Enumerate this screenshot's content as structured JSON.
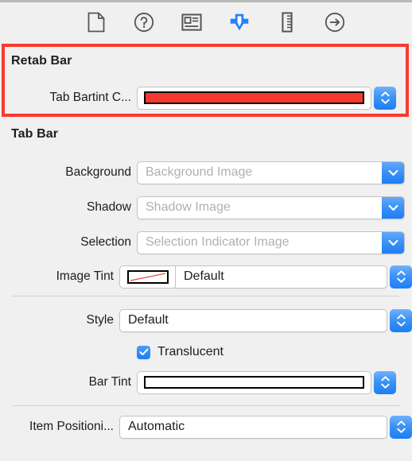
{
  "toolbar": {
    "items": [
      {
        "name": "file-inspector-icon",
        "title": "File inspector"
      },
      {
        "name": "quick-help-inspector-icon",
        "title": "Quick Help inspector"
      },
      {
        "name": "identity-inspector-icon",
        "title": "Identity inspector"
      },
      {
        "name": "attributes-inspector-icon",
        "title": "Attributes inspector",
        "selected": true
      },
      {
        "name": "size-inspector-icon",
        "title": "Size inspector"
      },
      {
        "name": "connections-inspector-icon",
        "title": "Connections inspector"
      }
    ],
    "selected_color": "#2482f5",
    "icon_color": "#555555"
  },
  "highlight": {
    "color": "#fa3b2e"
  },
  "sections": [
    {
      "title": "Retab Bar",
      "rows": [
        {
          "label": "Tab Bartint C...",
          "control": "color-well",
          "color": "#f4392d",
          "accessory": "stepper"
        }
      ]
    },
    {
      "title": "Tab Bar",
      "rows": [
        {
          "label": "Background",
          "control": "combo",
          "value": "",
          "placeholder": "Background Image",
          "accessory": "chevron-down"
        },
        {
          "label": "Shadow",
          "control": "combo",
          "value": "",
          "placeholder": "Shadow Image",
          "accessory": "chevron-down"
        },
        {
          "label": "Selection",
          "control": "combo",
          "value": "",
          "placeholder": "Selection Indicator Image",
          "accessory": "chevron-down"
        },
        {
          "label": "Image Tint",
          "control": "null-color-popup",
          "value": "Default",
          "accessory": "stepper"
        },
        {
          "label": "Style",
          "control": "popup",
          "value": "Default",
          "accessory": "stepper"
        },
        {
          "label": "",
          "control": "checkbox",
          "value": "Translucent",
          "checked": true
        },
        {
          "label": "Bar Tint",
          "control": "color-well",
          "color": "#ffffff",
          "accessory": "stepper"
        },
        {
          "label": "Item Positioni...",
          "control": "popup",
          "value": "Automatic",
          "accessory": "stepper"
        }
      ]
    }
  ]
}
